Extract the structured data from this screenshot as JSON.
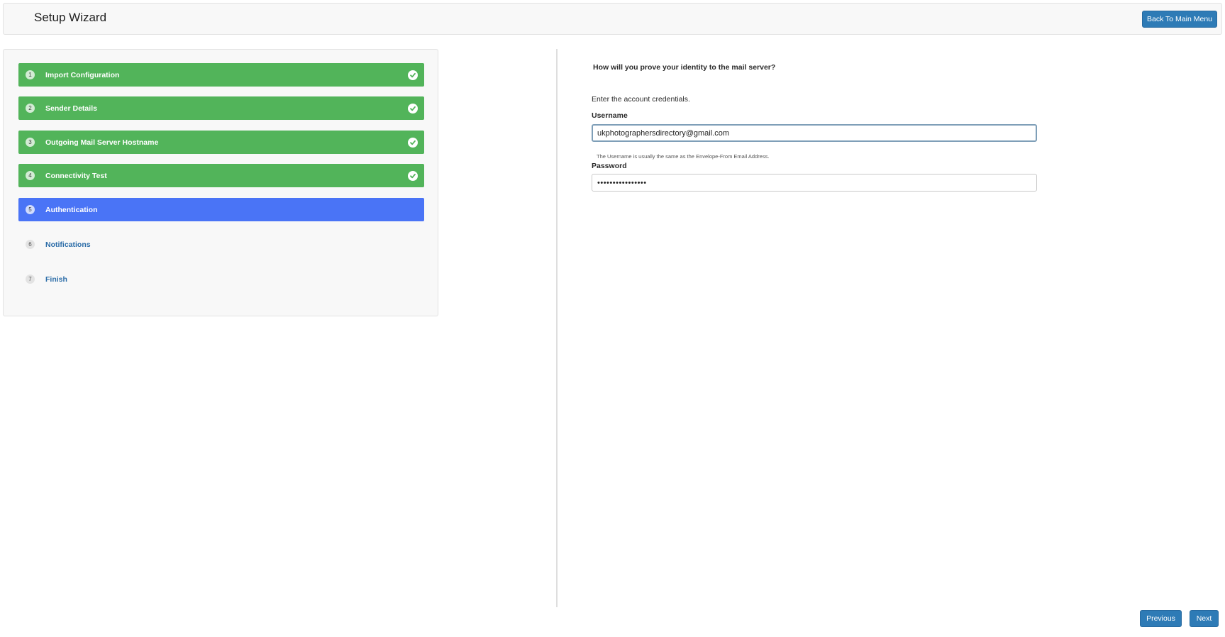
{
  "header": {
    "title": "Setup Wizard",
    "back_button": "Back To Main Menu"
  },
  "steps": [
    {
      "number": "1",
      "label": "Import Configuration",
      "state": "done"
    },
    {
      "number": "2",
      "label": "Sender Details",
      "state": "done"
    },
    {
      "number": "3",
      "label": "Outgoing Mail Server Hostname",
      "state": "done"
    },
    {
      "number": "4",
      "label": "Connectivity Test",
      "state": "done"
    },
    {
      "number": "5",
      "label": "Authentication",
      "state": "active"
    },
    {
      "number": "6",
      "label": "Notifications",
      "state": "pending"
    },
    {
      "number": "7",
      "label": "Finish",
      "state": "pending"
    }
  ],
  "form": {
    "question": "How will you prove your identity to the mail server?",
    "intro": "Enter the account credentials.",
    "username_label": "Username",
    "username_value": "ukphotographersdirectory@gmail.com",
    "username_help": "The Username is usually the same as the Envelope-From Email Address.",
    "password_label": "Password",
    "password_value": "••••••••••••••••"
  },
  "footer": {
    "previous_button": "Previous",
    "next_button": "Next"
  },
  "colors": {
    "done": "#52b45a",
    "active": "#4a74f6",
    "pending_text": "#2c6da8",
    "button": "#2e7bb6"
  }
}
